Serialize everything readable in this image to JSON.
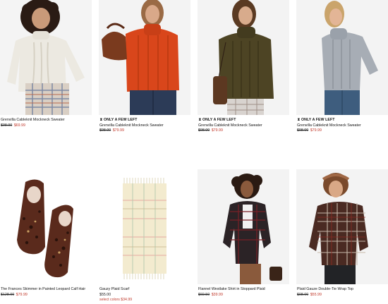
{
  "products": [
    {
      "name": "Grenvilla Cableknit Mockneck Sweater",
      "was_price": "$98.00",
      "sale_price": "$69.99",
      "badge": ""
    },
    {
      "name": "Grenvilla Cableknit Mockneck Sweater",
      "was_price": "$98.00",
      "sale_price": "$79.99",
      "badge": "ONLY A FEW LEFT"
    },
    {
      "name": "Grenvilla Cableknit Mockneck Sweater",
      "was_price": "$98.00",
      "sale_price": "$79.99",
      "badge": "ONLY A FEW LEFT"
    },
    {
      "name": "Grenvilla Cableknit Mockneck Sweater",
      "was_price": "$98.00",
      "sale_price": "$79.99",
      "badge": "ONLY A FEW LEFT"
    },
    {
      "name": "The Frances Skimmer in Painted Leopard Calf Hair",
      "was_price": "$128.00",
      "sale_price": "$79.99"
    },
    {
      "name": "Gauzy Plaid Scarf",
      "price": "$55.00",
      "colors_note": "select colors $34.99"
    },
    {
      "name": "Flannel Westlake Shirt in Stoppard Plaid",
      "was_price": "$69.50",
      "sale_price": "$39.99"
    },
    {
      "name": "Plaid Gauze Double-Tie Wrap Top",
      "was_price": "$98.00",
      "sale_price": "$55.99"
    }
  ],
  "colors": {
    "sale": "#c0392b",
    "text": "#111111",
    "photo_bg": "#f3f3f3"
  }
}
